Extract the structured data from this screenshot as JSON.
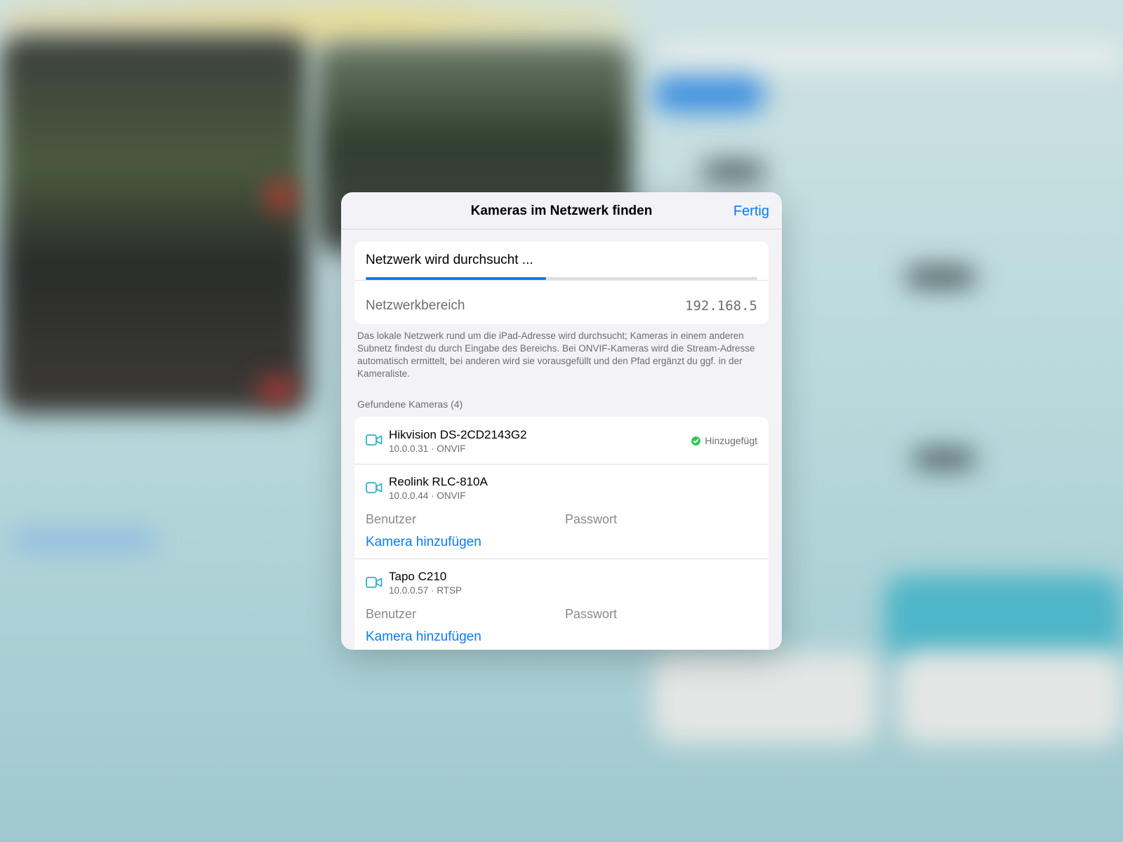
{
  "colors": {
    "accent": "#0a7aff",
    "success": "#34c759",
    "camera_icon": "#30b0c7"
  },
  "sheet": {
    "title": "Kameras im Netzwerk finden",
    "done_label": "Fertig"
  },
  "scan": {
    "status_text": "Netzwerk wird durchsucht ...",
    "progress": 0.46,
    "range_label": "Netzwerkbereich",
    "range_value": "192.168.5",
    "footnote": "Das lokale Netzwerk rund um die iPad-Adresse wird durchsucht; Kameras in einem anderen Subnetz findest du durch Eingabe des Bereichs. Bei ONVIF-Kameras wird die Stream-Adresse automatisch ermittelt, bei anderen wird sie vorausgefüllt und den Pfad ergänzt du ggf. in der Kameraliste."
  },
  "found": {
    "header": "Gefundene Kameras (4)",
    "cameras": [
      {
        "icon": "video-camera-icon",
        "name": "Hikvision DS-2CD2143G2",
        "subtitle": "10.0.0.31 · ONVIF",
        "status": "Hinzugefügt"
      },
      {
        "icon": "video-camera-icon",
        "name": "Reolink RLC-810A",
        "subtitle": "10.0.0.44 · ONVIF",
        "user_placeholder": "Benutzer",
        "password_placeholder": "Passwort",
        "add_label": "Kamera hinzufügen"
      },
      {
        "icon": "video-camera-icon",
        "name": "Tapo C210",
        "subtitle": "10.0.0.57 · RTSP",
        "user_placeholder": "Benutzer",
        "password_placeholder": "Passwort",
        "add_label": "Kamera hinzufügen"
      }
    ]
  }
}
